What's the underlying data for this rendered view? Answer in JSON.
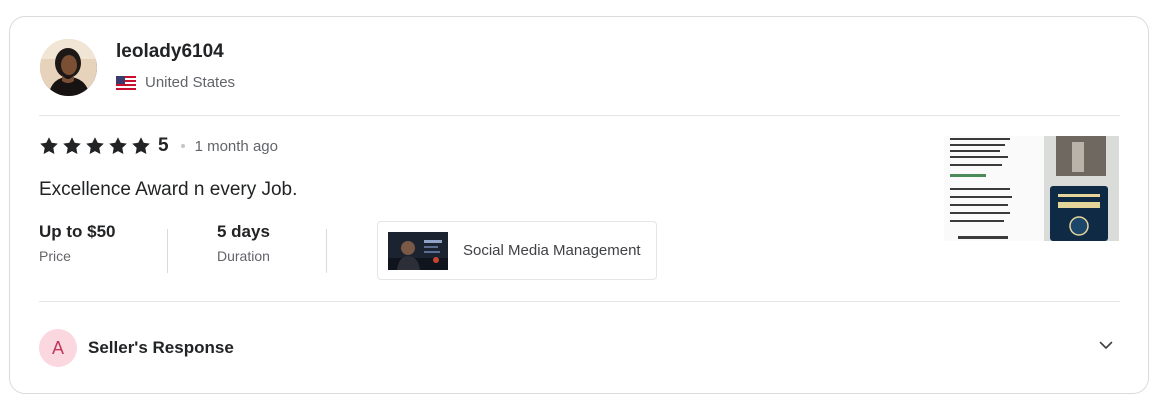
{
  "reviewer": {
    "username": "leolady6104",
    "country": "United States",
    "flag_icon": "us-flag-icon"
  },
  "review": {
    "stars": 5,
    "rating": "5",
    "time_ago": "1 month ago",
    "text": "Excellence Award n every Job."
  },
  "meta": {
    "price_value": "Up to $50",
    "price_label": "Price",
    "duration_value": "5 days",
    "duration_label": "Duration"
  },
  "gig": {
    "title": "Social Media Management"
  },
  "seller_response": {
    "avatar_letter": "A",
    "label": "Seller's Response",
    "toggle_icon": "chevron-down-icon"
  },
  "colors": {
    "star": "#222325",
    "response_avatar_bg": "#fbd7e0",
    "response_avatar_text": "#bf3a5a",
    "muted_text": "#62646a"
  }
}
